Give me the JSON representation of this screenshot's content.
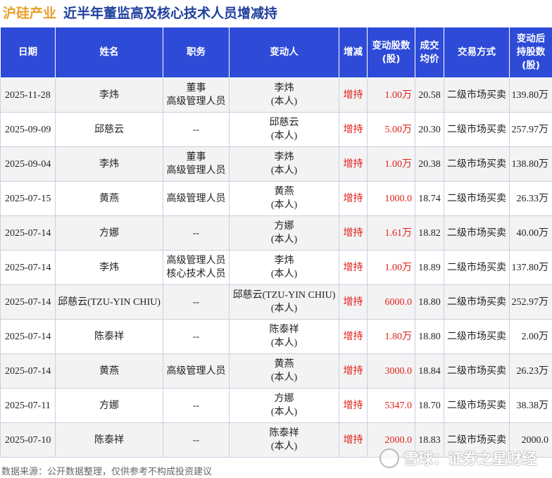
{
  "title": {
    "company": "沪硅产业",
    "main": "近半年董监高及核心技术人员增减持"
  },
  "headers": {
    "date": "日期",
    "name": "姓名",
    "role": "职务",
    "changer": "变动人",
    "direction": "增减",
    "shares_l1": "变动股数",
    "shares_l2": "(股)",
    "price_l1": "成交",
    "price_l2": "均价",
    "method": "交易方式",
    "after_l1": "变动后",
    "after_l2": "持股数",
    "after_l3": "(股)"
  },
  "rows": [
    {
      "date": "2025-11-28",
      "name": "李炜",
      "role1": "董事",
      "role2": "高级管理人员",
      "changer1": "李炜",
      "changer2": "(本人)",
      "direction": "增持",
      "shares": "1.00万",
      "price": "20.58",
      "method": "二级市场买卖",
      "after": "139.80万"
    },
    {
      "date": "2025-09-09",
      "name": "邱慈云",
      "role1": "--",
      "role2": "",
      "changer1": "邱慈云",
      "changer2": "(本人)",
      "direction": "增持",
      "shares": "5.00万",
      "price": "20.30",
      "method": "二级市场买卖",
      "after": "257.97万"
    },
    {
      "date": "2025-09-04",
      "name": "李炜",
      "role1": "董事",
      "role2": "高级管理人员",
      "changer1": "李炜",
      "changer2": "(本人)",
      "direction": "增持",
      "shares": "1.00万",
      "price": "20.38",
      "method": "二级市场买卖",
      "after": "138.80万"
    },
    {
      "date": "2025-07-15",
      "name": "黄燕",
      "role1": "高级管理人员",
      "role2": "",
      "changer1": "黄燕",
      "changer2": "(本人)",
      "direction": "增持",
      "shares": "1000.0",
      "price": "18.74",
      "method": "二级市场买卖",
      "after": "26.33万"
    },
    {
      "date": "2025-07-14",
      "name": "方娜",
      "role1": "--",
      "role2": "",
      "changer1": "方娜",
      "changer2": "(本人)",
      "direction": "增持",
      "shares": "1.61万",
      "price": "18.82",
      "method": "二级市场买卖",
      "after": "40.00万"
    },
    {
      "date": "2025-07-14",
      "name": "李炜",
      "role1": "高级管理人员",
      "role2": "核心技术人员",
      "changer1": "李炜",
      "changer2": "(本人)",
      "direction": "增持",
      "shares": "1.00万",
      "price": "18.89",
      "method": "二级市场买卖",
      "after": "137.80万"
    },
    {
      "date": "2025-07-14",
      "name": "邱慈云(TZU-YIN CHIU)",
      "role1": "--",
      "role2": "",
      "changer1": "邱慈云(TZU-YIN CHIU)",
      "changer2": "(本人)",
      "direction": "增持",
      "shares": "6000.0",
      "price": "18.80",
      "method": "二级市场买卖",
      "after": "252.97万"
    },
    {
      "date": "2025-07-14",
      "name": "陈泰祥",
      "role1": "--",
      "role2": "",
      "changer1": "陈泰祥",
      "changer2": "(本人)",
      "direction": "增持",
      "shares": "1.80万",
      "price": "18.80",
      "method": "二级市场买卖",
      "after": "2.00万"
    },
    {
      "date": "2025-07-14",
      "name": "黄燕",
      "role1": "高级管理人员",
      "role2": "",
      "changer1": "黄燕",
      "changer2": "(本人)",
      "direction": "增持",
      "shares": "3000.0",
      "price": "18.84",
      "method": "二级市场买卖",
      "after": "26.23万"
    },
    {
      "date": "2025-07-11",
      "name": "方娜",
      "role1": "--",
      "role2": "",
      "changer1": "方娜",
      "changer2": "(本人)",
      "direction": "增持",
      "shares": "5347.0",
      "price": "18.70",
      "method": "二级市场买卖",
      "after": "38.38万"
    },
    {
      "date": "2025-07-10",
      "name": "陈泰祥",
      "role1": "--",
      "role2": "",
      "changer1": "陈泰祥",
      "changer2": "(本人)",
      "direction": "增持",
      "shares": "2000.0",
      "price": "18.83",
      "method": "二级市场买卖",
      "after": "2000.0"
    }
  ],
  "footer": {
    "source": "数据来源：公开数据整理，仅供参考不构成投资建议",
    "watermark": "雪球：证券之星财经"
  },
  "colors": {
    "header_bg": "#2e4bd8",
    "increase_red": "#e0201b",
    "company_orange": "#e8a02a",
    "title_blue": "#1f3f9c"
  }
}
